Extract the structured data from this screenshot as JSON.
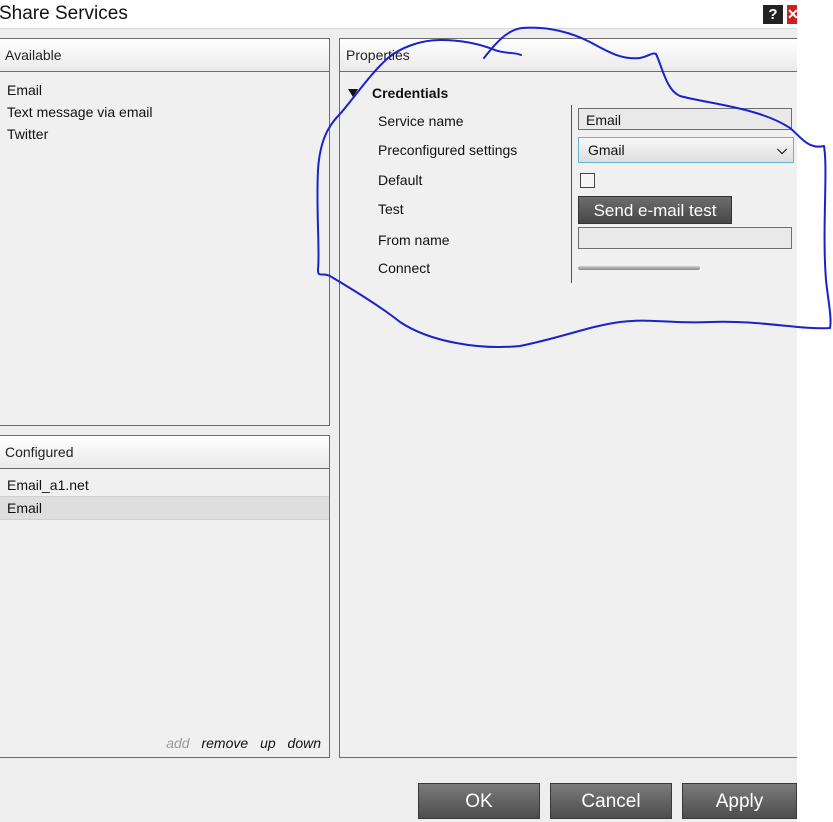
{
  "window": {
    "title": "Share Services",
    "help_label": "?",
    "close_label": "✕"
  },
  "available": {
    "header": "Available",
    "items": [
      "Email",
      "Text message via email",
      "Twitter"
    ]
  },
  "configured": {
    "header": "Configured",
    "items": [
      "Email_a1.net",
      "Email"
    ],
    "selected_index": 1,
    "actions": {
      "add": "add",
      "remove": "remove",
      "up": "up",
      "down": "down"
    }
  },
  "properties": {
    "header": "Properties",
    "section": "Credentials",
    "labels": {
      "service_name": "Service name",
      "preconfigured": "Preconfigured settings",
      "default": "Default",
      "test": "Test",
      "from_name": "From name",
      "connect": "Connect"
    },
    "values": {
      "service_name": "Email",
      "preconfigured": "Gmail",
      "default_checked": false,
      "test_button": "Send e-mail test",
      "from_name": ""
    }
  },
  "footer": {
    "ok": "OK",
    "cancel": "Cancel",
    "apply": "Apply"
  },
  "colors": {
    "annotation": "#1a22cc",
    "button_dark": "#4d4d4d",
    "select_focus": "#62b6d6"
  }
}
